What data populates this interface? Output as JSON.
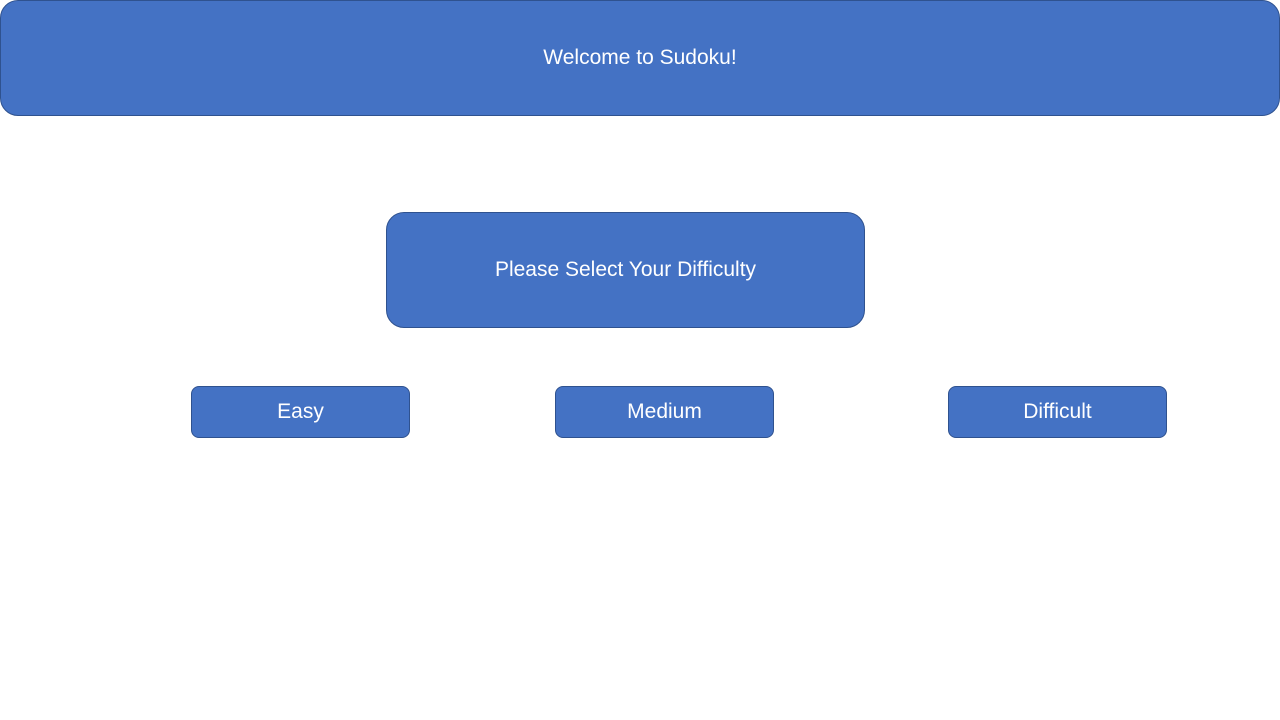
{
  "header": {
    "title": "Welcome to Sudoku!"
  },
  "prompt": {
    "text": "Please Select Your Difficulty"
  },
  "difficulty": {
    "buttons": [
      {
        "label": "Easy"
      },
      {
        "label": "Medium"
      },
      {
        "label": "Difficult"
      }
    ]
  },
  "colors": {
    "accent": "#4472c4",
    "border": "#2f528f",
    "text": "#ffffff",
    "background": "#ffffff"
  }
}
